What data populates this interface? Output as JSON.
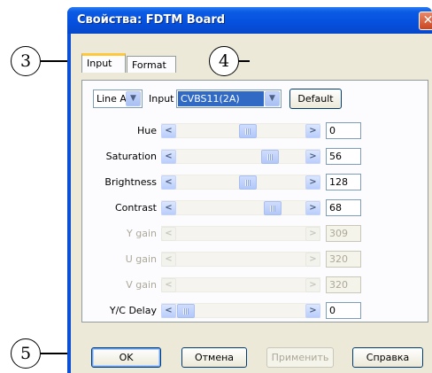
{
  "window": {
    "title": "Свойства: FDTM Board",
    "close_glyph": "✕"
  },
  "tabs": [
    {
      "label": "Input",
      "active": true
    },
    {
      "label": "Format",
      "active": false
    }
  ],
  "top_row": {
    "line_select": "Line A",
    "input_label": "Input",
    "input_select": "CVBS11(2A)",
    "default_button": "Default"
  },
  "sliders": [
    {
      "label": "Hue",
      "value": "0",
      "enabled": true
    },
    {
      "label": "Saturation",
      "value": "56",
      "enabled": true
    },
    {
      "label": "Brightness",
      "value": "128",
      "enabled": true
    },
    {
      "label": "Contrast",
      "value": "68",
      "enabled": true
    },
    {
      "label": "Y gain",
      "value": "309",
      "enabled": false
    },
    {
      "label": "U gain",
      "value": "320",
      "enabled": false
    },
    {
      "label": "V gain",
      "value": "320",
      "enabled": false
    },
    {
      "label": "Y/C Delay",
      "value": "0",
      "enabled": true
    }
  ],
  "footer": {
    "ok": "OK",
    "cancel": "Отмена",
    "apply": "Применить",
    "help": "Справка"
  },
  "callouts": [
    "3",
    "4",
    "5"
  ],
  "icons": {
    "left_arrow": "<",
    "right_arrow": ">",
    "dropdown": "▼"
  }
}
